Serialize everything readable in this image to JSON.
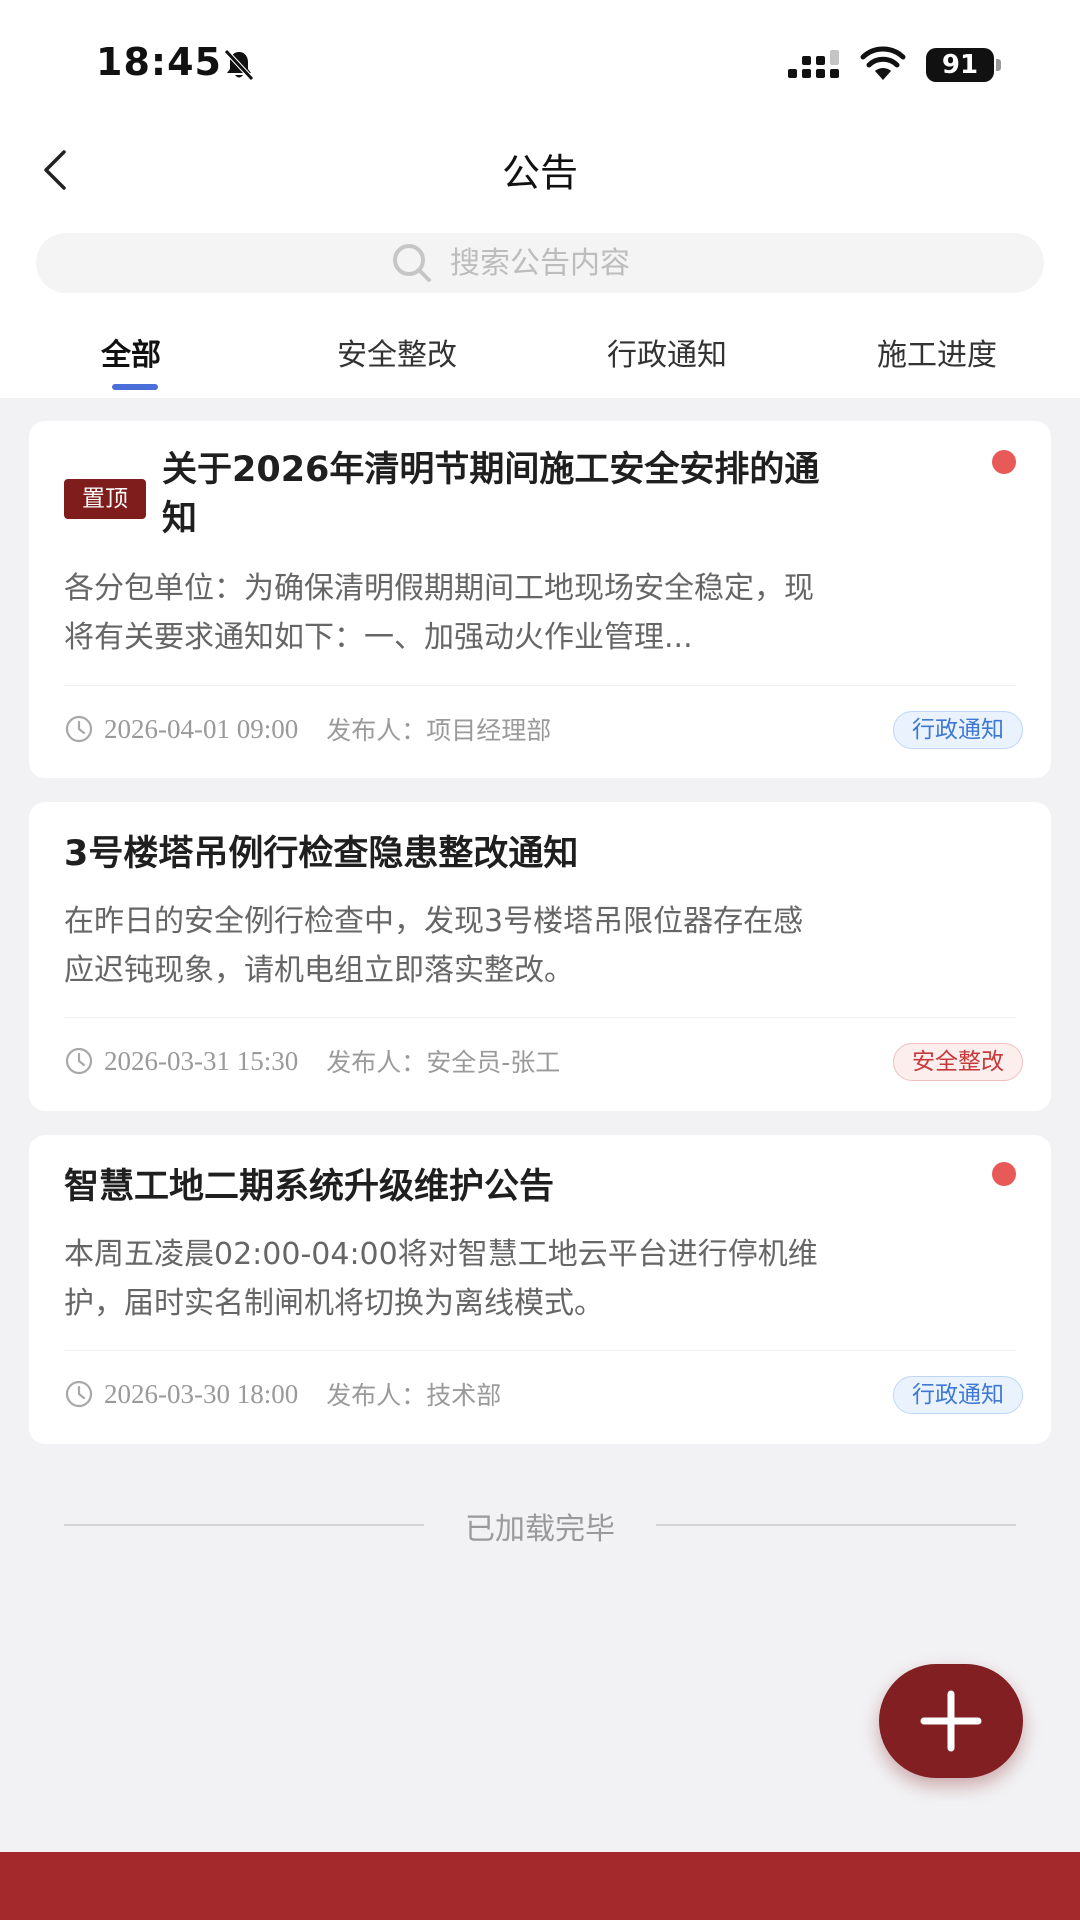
{
  "status_bar": {
    "time": "18:45",
    "battery": "91"
  },
  "header": {
    "title": "公告"
  },
  "search": {
    "placeholder": "搜索公告内容"
  },
  "tabs": [
    {
      "label": "全部",
      "active": true
    },
    {
      "label": "安全整改",
      "active": false
    },
    {
      "label": "行政通知",
      "active": false
    },
    {
      "label": "施工进度",
      "active": false
    }
  ],
  "notices": [
    {
      "pinned": true,
      "pin_label": "置顶",
      "unread": true,
      "title_line1": "关于2026年清明节期间施工安全安排的通",
      "title_line2": "知",
      "summary_line1": "各分包单位：为确保清明假期期间工地现场安全稳定，现",
      "summary_line2": "将有关要求通知如下：一、加强动火作业管理...",
      "time": "2026-04-01 09:00",
      "publisher": "发布人：项目经理部",
      "category": "行政通知",
      "category_color": "#3e78d4"
    },
    {
      "pinned": false,
      "unread": false,
      "title": "3号楼塔吊例行检查隐患整改通知",
      "summary_line1": "在昨日的安全例行检查中，发现3号楼塔吊限位器存在感",
      "summary_line2": "应迟钝现象，请机电组立即落实整改。",
      "time": "2026-03-31 15:30",
      "publisher": "发布人：安全员-张工",
      "category": "安全整改",
      "category_color": "#c8383a"
    },
    {
      "pinned": false,
      "unread": true,
      "title": "智慧工地二期系统升级维护公告",
      "summary_line1": "本周五凌晨02:00-04:00将对智慧工地云平台进行停机维",
      "summary_line2": "护，届时实名制闸机将切换为离线模式。",
      "time": "2026-03-30 18:00",
      "publisher": "发布人：技术部",
      "category": "行政通知",
      "category_color": "#3e78d4"
    }
  ],
  "list_footer": {
    "loaded_text": "已加载完毕"
  },
  "colors": {
    "brand": "#821f22",
    "tab_indicator": "#4a6fd8",
    "unread_dot": "#e85a57"
  }
}
